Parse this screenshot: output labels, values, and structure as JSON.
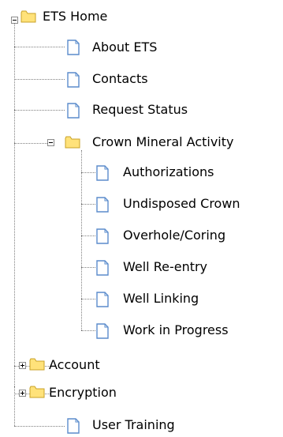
{
  "tree": {
    "root": {
      "label": "ETS Home",
      "expanded": true,
      "icon": "folder-open-icon"
    },
    "children": [
      {
        "label": "About ETS",
        "icon": "document-icon"
      },
      {
        "label": "Contacts",
        "icon": "document-icon"
      },
      {
        "label": "Request Status",
        "icon": "document-icon"
      },
      {
        "label": "Crown Mineral Activity",
        "icon": "folder-open-icon",
        "expanded": true,
        "children": [
          {
            "label": "Authorizations",
            "icon": "document-icon"
          },
          {
            "label": "Undisposed Crown",
            "icon": "document-icon"
          },
          {
            "label": "Overhole/Coring",
            "icon": "document-icon"
          },
          {
            "label": "Well Re-entry",
            "icon": "document-icon"
          },
          {
            "label": "Well Linking",
            "icon": "document-icon"
          },
          {
            "label": "Work in Progress",
            "icon": "document-icon"
          }
        ]
      },
      {
        "label": "Account",
        "icon": "folder-closed-icon",
        "expanded": false
      },
      {
        "label": "Encryption",
        "icon": "folder-closed-icon",
        "expanded": false
      },
      {
        "label": "User Training",
        "icon": "document-icon"
      }
    ]
  },
  "colors": {
    "folder_fill": "#ffe27a",
    "folder_border": "#c8a227",
    "document_fill": "#ffffff",
    "document_border": "#5b8ccc",
    "connector": "#7f7f7f"
  }
}
